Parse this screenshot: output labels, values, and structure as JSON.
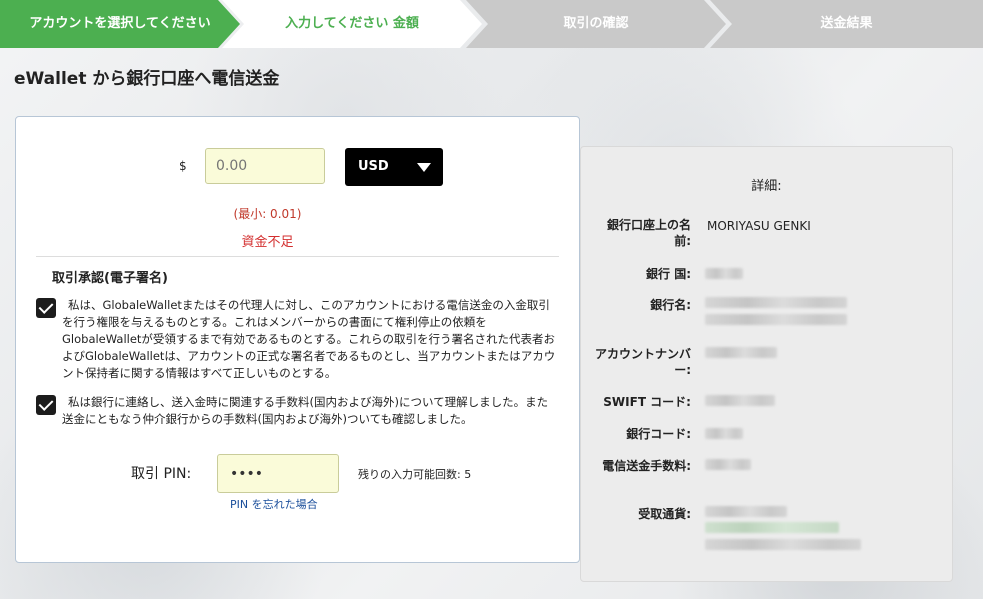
{
  "steps": [
    {
      "label": "アカウントを選択してください"
    },
    {
      "label": "入力してください 金額"
    },
    {
      "label": "取引の確認"
    },
    {
      "label": "送金結果"
    }
  ],
  "page_title": "eWallet から銀行口座へ電信送金",
  "form": {
    "currency_symbol": "$",
    "amount_placeholder": "0.00",
    "currency": "USD",
    "min_note": "(最小: 0.01)",
    "insufficient": "資金不足",
    "section_title": "取引承認(電子署名)",
    "consent1": "私は、GlobaleWalletまたはその代理人に対し、このアカウントにおける電信送金の入金取引を行う権限を与えるものとする。これはメンバーからの書面にて権利停止の依頼をGlobaleWalletが受領するまで有効であるものとする。これらの取引を行う署名された代表者およびGlobaleWalletは、アカウントの正式な署名者であるものとし、当アカウントまたはアカウント保持者に関する情報はすべて正しいものとする。",
    "consent2": "私は銀行に連絡し、送入金時に関連する手数料(国内および海外)について理解しました。また送金にともなう仲介銀行からの手数料(国内および海外)ついても確認しました。",
    "pin_label": "取引 PIN:",
    "pin_value": "••••",
    "pin_remaining": "残りの入力可能回数: 5",
    "pin_forgot": "PIN を忘れた場合"
  },
  "details": {
    "heading": "詳細:",
    "account_name_label": "銀行口座上の名前:",
    "account_name_value": "MORIYASU GENKI",
    "bank_country_label": "銀行 国:",
    "bank_name_label": "銀行名:",
    "account_number_label": "アカウントナンバー:",
    "swift_label": "SWIFT コード:",
    "bank_code_label": "銀行コード:",
    "fee_label": "電信送金手数料:",
    "receive_currency_label": "受取通貨:"
  }
}
